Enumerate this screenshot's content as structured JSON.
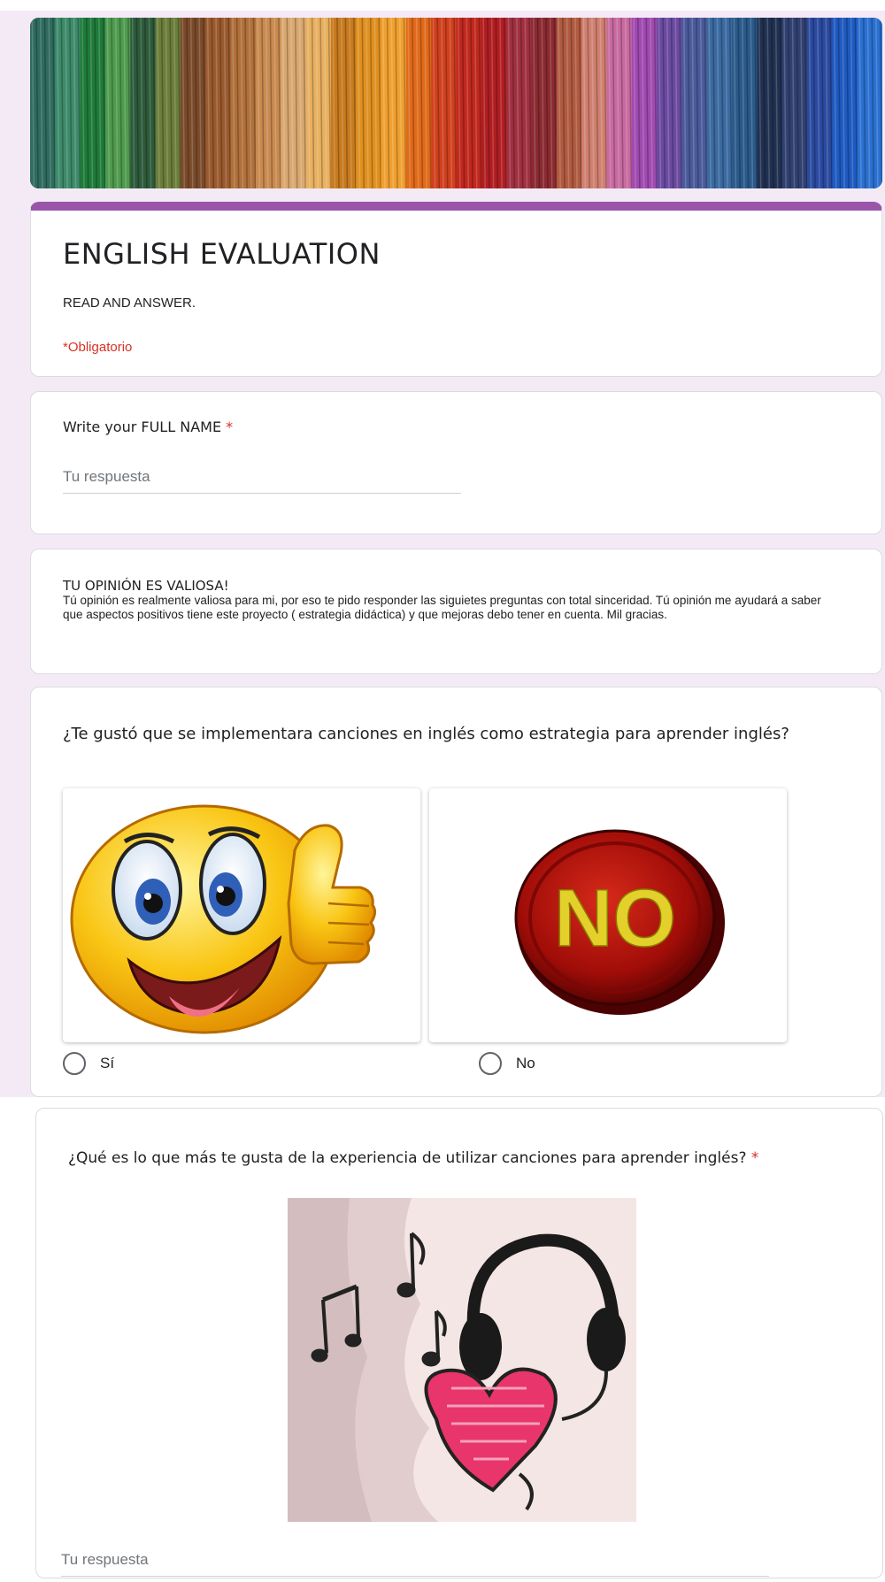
{
  "form": {
    "title": "ENGLISH EVALUATION",
    "description": "READ AND ANSWER.",
    "required_note": "*Obligatorio",
    "accent_color": "#9a55a8",
    "required_color": "#d93025"
  },
  "questions": {
    "full_name": {
      "label": "Write your FULL NAME",
      "required_mark": "*",
      "placeholder": "Tu respuesta"
    },
    "opinion_section": {
      "title": "TU OPINIÓN ES VALIOSA!",
      "body": "Tú opinión es realmente valiosa para mi, por eso te pido responder las siguietes preguntas con total sinceridad. Tú opinión me ayudará a saber que aspectos positivos tiene este proyecto ( estrategia didáctica)  y que mejoras debo tener en cuenta. Mil gracias."
    },
    "songs_liked": {
      "label": "¿Te gustó que se implementara canciones en inglés como estrategia para aprender inglés?",
      "options": [
        {
          "label": "Sí",
          "image": "thumbs-up-smiley"
        },
        {
          "label": "No",
          "image": "red-no-button",
          "image_text": "NO"
        }
      ]
    },
    "what_you_like": {
      "label": "¿Qué es lo que más te gusta de la experiencia de utilizar canciones para aprender inglés?",
      "required_mark": "*",
      "image": "headphones-heart-music-notes",
      "placeholder": "Tu respuesta"
    }
  }
}
